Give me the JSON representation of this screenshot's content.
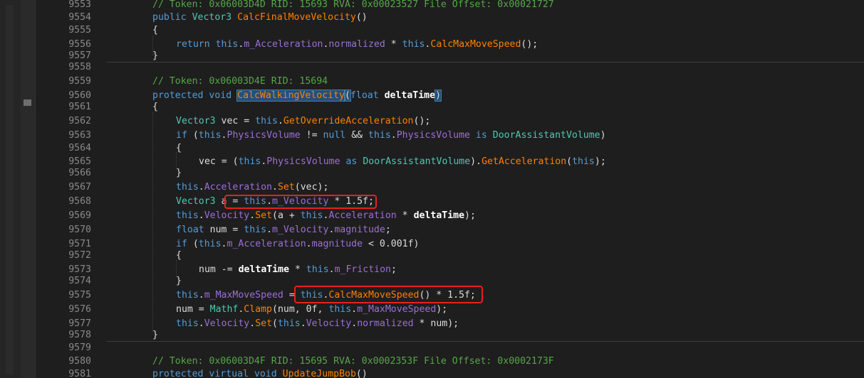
{
  "line_numbers": [
    "9553",
    "9554",
    "9555",
    "9556",
    "9557",
    "9558",
    "9559",
    "9560",
    "9561",
    "9562",
    "9563",
    "9564",
    "9565",
    "9566",
    "9567",
    "9568",
    "9569",
    "9570",
    "9571",
    "9572",
    "9573",
    "9574",
    "9575",
    "9576",
    "9577",
    "9578",
    "9579",
    "9580",
    "9581"
  ],
  "code": {
    "l9553": "// Token: 0x06003D4D RID: 15693 RVA: 0x00023527 File Offset: 0x00021727",
    "l9554_kw": "public",
    "l9554_ty": "Vector3",
    "l9554_fn": "CalcFinalMoveVelocity",
    "l9554_rest": "()",
    "l9555": "{",
    "l9556_kw": "return",
    "l9556_this1": "this",
    "l9556_fld": "m_Acceleration",
    "l9556_pp": "normalized",
    "l9556_op": " * ",
    "l9556_this2": "this",
    "l9556_fn": "CalcMaxMoveSpeed",
    "l9556_end": "();",
    "l9557": "}",
    "l9559": "// Token: 0x06003D4E RID: 15694",
    "l9560_kw1": "protected",
    "l9560_kw2": "void",
    "l9560_fn": "CalcWalkingVelocity",
    "l9560_kw3": "float",
    "l9560_param": "deltaTime",
    "l9561": "{",
    "l9562_ty": "Vector3",
    "l9562_var": " vec = ",
    "l9562_this": "this",
    "l9562_fn": "GetOverrideAcceleration",
    "l9562_end": "();",
    "l9563_kw": "if",
    "l9563_this1": "this",
    "l9563_pp": "PhysicsVolume",
    "l9563_op": " != ",
    "l9563_null": "null",
    "l9563_and": " && ",
    "l9563_this2": "this",
    "l9563_pp2": "PhysicsVolume",
    "l9563_is": "is",
    "l9563_ty": "DoorAssistantVolume",
    "l9564": "{",
    "l9565_var": "vec = (",
    "l9565_this": "this",
    "l9565_pp": "PhysicsVolume",
    "l9565_as": "as",
    "l9565_ty": "DoorAssistantVolume",
    "l9565_fn": "GetAcceleration",
    "l9565_this2": "this",
    "l9566": "}",
    "l9567_this": "this",
    "l9567_pp": "Acceleration",
    "l9567_fn": "Set",
    "l9567_end": "(vec);",
    "l9568_ty": "Vector3",
    "l9568_a": " a ",
    "l9568_eq": "= ",
    "l9568_this": "this",
    "l9568_fld": "m_Velocity",
    "l9568_end": " * 1.5f;",
    "l9569_this": "this",
    "l9569_pp": "Velocity",
    "l9569_fn": "Set",
    "l9569_mid": "(a + ",
    "l9569_this2": "this",
    "l9569_pp2": "Acceleration",
    "l9569_op": " * ",
    "l9569_param": "deltaTime",
    "l9569_end": ");",
    "l9570_kw": "float",
    "l9570_var": " num = ",
    "l9570_this": "this",
    "l9570_fld": "m_Velocity",
    "l9570_pp": "magnitude",
    "l9570_end": ";",
    "l9571_kw": "if",
    "l9571_this": "this",
    "l9571_fld": "m_Acceleration",
    "l9571_pp": "magnitude",
    "l9571_end": " < 0.001f)",
    "l9572": "{",
    "l9573_var": "num -= ",
    "l9573_param": "deltaTime",
    "l9573_op": " * ",
    "l9573_this": "this",
    "l9573_fld": "m_Friction",
    "l9573_end": ";",
    "l9574": "}",
    "l9575_this": "this",
    "l9575_fld": "m_MaxMoveSpeed",
    "l9575_eq": " = ",
    "l9575_this2": "this",
    "l9575_fn": "CalcMaxMoveSpeed",
    "l9575_end": "() * 1.5f;",
    "l9576_var": "num = ",
    "l9576_ty": "Mathf",
    "l9576_fn": "Clamp",
    "l9576_mid": "(num, 0f, ",
    "l9576_this": "this",
    "l9576_fld": "m_MaxMoveSpeed",
    "l9576_end": ");",
    "l9577_this": "this",
    "l9577_pp": "Velocity",
    "l9577_fn": "Set",
    "l9577_this2": "this",
    "l9577_pp2": "Velocity",
    "l9577_pp3": "normalized",
    "l9577_end": " * num);",
    "l9578": "}",
    "l9580": "// Token: 0x06003D4F RID: 15695 RVA: 0x0002353F File Offset: 0x0002173F",
    "l9581_kw1": "protected",
    "l9581_kw2": "virtual",
    "l9581_kw3": "void",
    "l9581_fn": "UpdateJumpBob",
    "l9581_end": "()"
  },
  "colors": {
    "background": "#1e1e1e",
    "keyword": "#569cd6",
    "type": "#4ec9b0",
    "method": "#ff8000",
    "comment": "#57a64a",
    "field": "#9b6fd6",
    "annotation_box": "#e8201e"
  }
}
